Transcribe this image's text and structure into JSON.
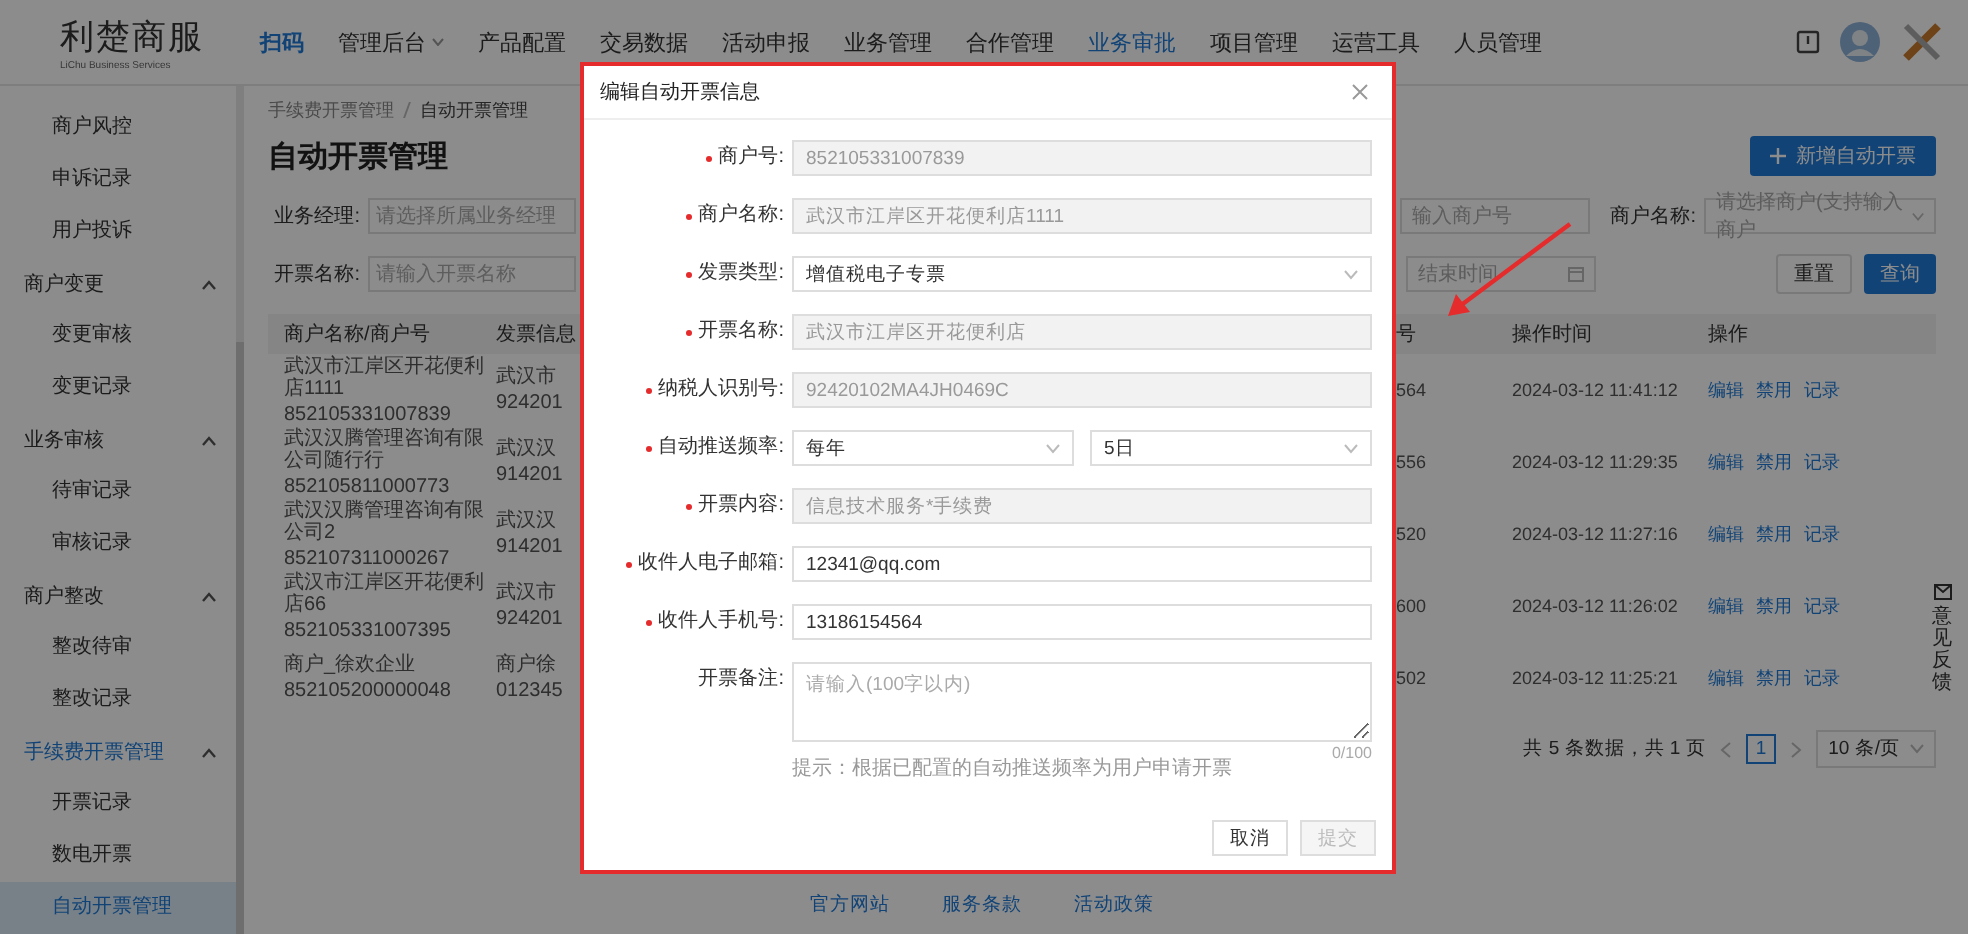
{
  "header": {
    "logo": {
      "name": "利楚商服",
      "tagline": "LiChu Business Services"
    },
    "nav": [
      {
        "label": "扫码",
        "kind": "accent",
        "selected": false
      },
      {
        "label": "管理后台",
        "kind": "dropdown",
        "selected": false
      },
      {
        "label": "产品配置",
        "kind": "link",
        "selected": false
      },
      {
        "label": "交易数据",
        "kind": "link",
        "selected": false
      },
      {
        "label": "活动申报",
        "kind": "link",
        "selected": false
      },
      {
        "label": "业务管理",
        "kind": "link",
        "selected": false
      },
      {
        "label": "合作管理",
        "kind": "link",
        "selected": false
      },
      {
        "label": "业务审批",
        "kind": "link",
        "selected": true
      },
      {
        "label": "项目管理",
        "kind": "link",
        "selected": false
      },
      {
        "label": "运营工具",
        "kind": "link",
        "selected": false
      },
      {
        "label": "人员管理",
        "kind": "link",
        "selected": false
      }
    ]
  },
  "sidebar": {
    "items": [
      {
        "kind": "link",
        "label": "商户风控",
        "selected": false
      },
      {
        "kind": "link",
        "label": "申诉记录",
        "selected": false
      },
      {
        "kind": "link",
        "label": "用户投诉",
        "selected": false
      },
      {
        "kind": "group",
        "label": "商户变更",
        "expanded": true,
        "active": false,
        "children": [
          {
            "label": "变更审核",
            "selected": false
          },
          {
            "label": "变更记录",
            "selected": false
          }
        ]
      },
      {
        "kind": "group",
        "label": "业务审核",
        "expanded": true,
        "active": false,
        "children": [
          {
            "label": "待审记录",
            "selected": false
          },
          {
            "label": "审核记录",
            "selected": false
          }
        ]
      },
      {
        "kind": "group",
        "label": "商户整改",
        "expanded": true,
        "active": false,
        "children": [
          {
            "label": "整改待审",
            "selected": false
          },
          {
            "label": "整改记录",
            "selected": false
          }
        ]
      },
      {
        "kind": "group",
        "label": "手续费开票管理",
        "expanded": true,
        "active": true,
        "children": [
          {
            "label": "开票记录",
            "selected": false
          },
          {
            "label": "数电开票",
            "selected": false
          },
          {
            "label": "自动开票管理",
            "selected": true
          }
        ]
      }
    ]
  },
  "breadcrumb": [
    "手续费开票管理",
    "自动开票管理"
  ],
  "page_title": "自动开票管理",
  "add_button": "新增自动开票",
  "filters": {
    "business_manager": {
      "label": "业务经理:",
      "placeholder": "请选择所属业务经理"
    },
    "invoice_name": {
      "label": "开票名称:",
      "placeholder": "请输入开票名称"
    },
    "merchant_no": {
      "placeholder": "输入商户号"
    },
    "merchant_name": {
      "label": "商户名称:",
      "placeholder": "请选择商户(支持输入商户"
    },
    "end_time": {
      "placeholder": "结束时间"
    },
    "reset_button": "重置",
    "search_button": "查询"
  },
  "table": {
    "columns": [
      "商户名称/商户号",
      "发票信息",
      "号",
      "操作时间",
      "操作"
    ],
    "rows": [
      {
        "merchant_name": "武汉市江岸区开花便利店1111",
        "merchant_no": "852105331007839",
        "column_2": [
          "武汉市",
          "924201"
        ],
        "column_3": "564",
        "time": "2024-03-12 11:41:12",
        "actions": [
          "编辑",
          "禁用",
          "记录"
        ]
      },
      {
        "merchant_name": "武汉汉腾管理咨询有限公司随行行",
        "merchant_no": "852105811000773",
        "column_2": [
          "武汉汉",
          "914201"
        ],
        "column_3": "556",
        "time": "2024-03-12 11:29:35",
        "actions": [
          "编辑",
          "禁用",
          "记录"
        ]
      },
      {
        "merchant_name": "武汉汉腾管理咨询有限公司2",
        "merchant_no": "852107311000267",
        "column_2": [
          "武汉汉",
          "914201"
        ],
        "column_3": "520",
        "time": "2024-03-12 11:27:16",
        "actions": [
          "编辑",
          "禁用",
          "记录"
        ]
      },
      {
        "merchant_name": "武汉市江岸区开花便利店66",
        "merchant_no": "852105331007395",
        "column_2": [
          "武汉市",
          "924201"
        ],
        "column_3": "600",
        "time": "2024-03-12 11:26:02",
        "actions": [
          "编辑",
          "禁用",
          "记录"
        ]
      },
      {
        "merchant_name": "商户_徐欢企业",
        "merchant_no": "852105200000048",
        "column_2": [
          "商户徐",
          "012345"
        ],
        "column_3": "502",
        "time": "2024-03-12 11:25:21",
        "actions": [
          "编辑",
          "禁用",
          "记录"
        ]
      }
    ]
  },
  "pagination": {
    "summary": "共 5 条数据，共 1 页",
    "pages": [
      {
        "label": "1",
        "selected": true
      }
    ],
    "page_size": "10 条/页"
  },
  "footer_links": [
    "官方网站",
    "服务条款",
    "活动政策"
  ],
  "feedback": {
    "label": "意见反馈"
  },
  "modal": {
    "title": "编辑自动开票信息",
    "fields": [
      {
        "label": "商户号:",
        "required": true,
        "kind": "input",
        "value": "852105331007839",
        "disabled": true
      },
      {
        "label": "商户名称:",
        "required": true,
        "kind": "input",
        "value": "武汉市江岸区开花便利店1111",
        "disabled": true
      },
      {
        "label": "发票类型:",
        "required": true,
        "kind": "select",
        "value": "增值税电子专票",
        "disabled": false
      },
      {
        "label": "开票名称:",
        "required": true,
        "kind": "input",
        "value": "武汉市江岸区开花便利店",
        "disabled": true
      },
      {
        "label": "纳税人识别号:",
        "required": true,
        "kind": "input",
        "value": "92420102MA4JH0469C",
        "disabled": true
      },
      {
        "label": "自动推送频率:",
        "required": true,
        "kind": "double_select",
        "values": [
          "每年",
          "5日"
        ],
        "disabled": false
      },
      {
        "label": "开票内容:",
        "required": true,
        "kind": "input",
        "value": "信息技术服务*手续费",
        "disabled": true
      },
      {
        "label": "收件人电子邮箱:",
        "required": true,
        "kind": "input",
        "value": "12341@qq.com",
        "disabled": false
      },
      {
        "label": "收件人手机号:",
        "required": true,
        "kind": "input",
        "value": "13186154564",
        "disabled": false
      },
      {
        "label": "开票备注:",
        "required": false,
        "kind": "textarea",
        "placeholder": "请输入(100字以内)",
        "counter": "0/100",
        "disabled": false
      }
    ],
    "hint": "提示：根据已配置的自动推送频率为用户申请开票",
    "buttons": [
      {
        "label": "取消",
        "disabled": false
      },
      {
        "label": "提交",
        "disabled": true
      }
    ]
  }
}
